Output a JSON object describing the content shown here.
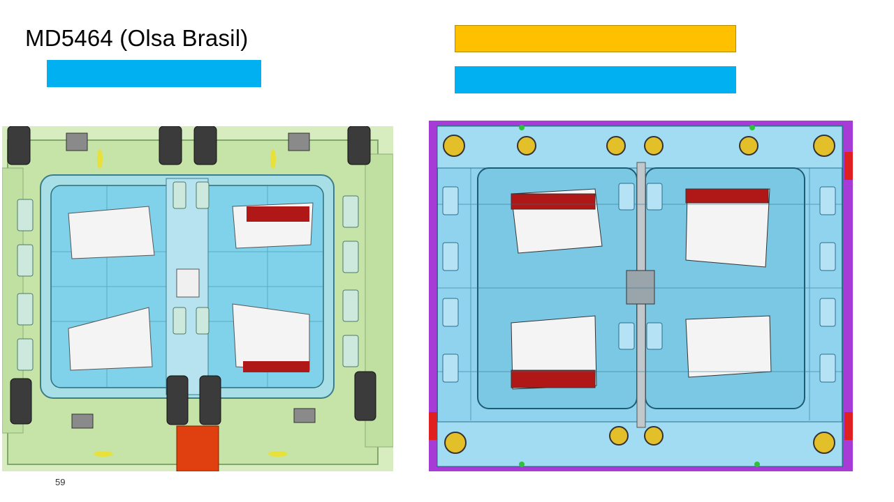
{
  "slide": {
    "title": "MD5464 (Olsa Brasil)",
    "page_number": "59"
  },
  "colors": {
    "label_blue": "#00b0f0",
    "label_orange": "#ffc000",
    "mold_green": "#cfe8b4",
    "mold_purple": "#a63bd6",
    "cavity_red": "#b01818"
  },
  "images": {
    "left": "mold-cad-render-green",
    "right": "mold-cad-render-blue-purple"
  }
}
